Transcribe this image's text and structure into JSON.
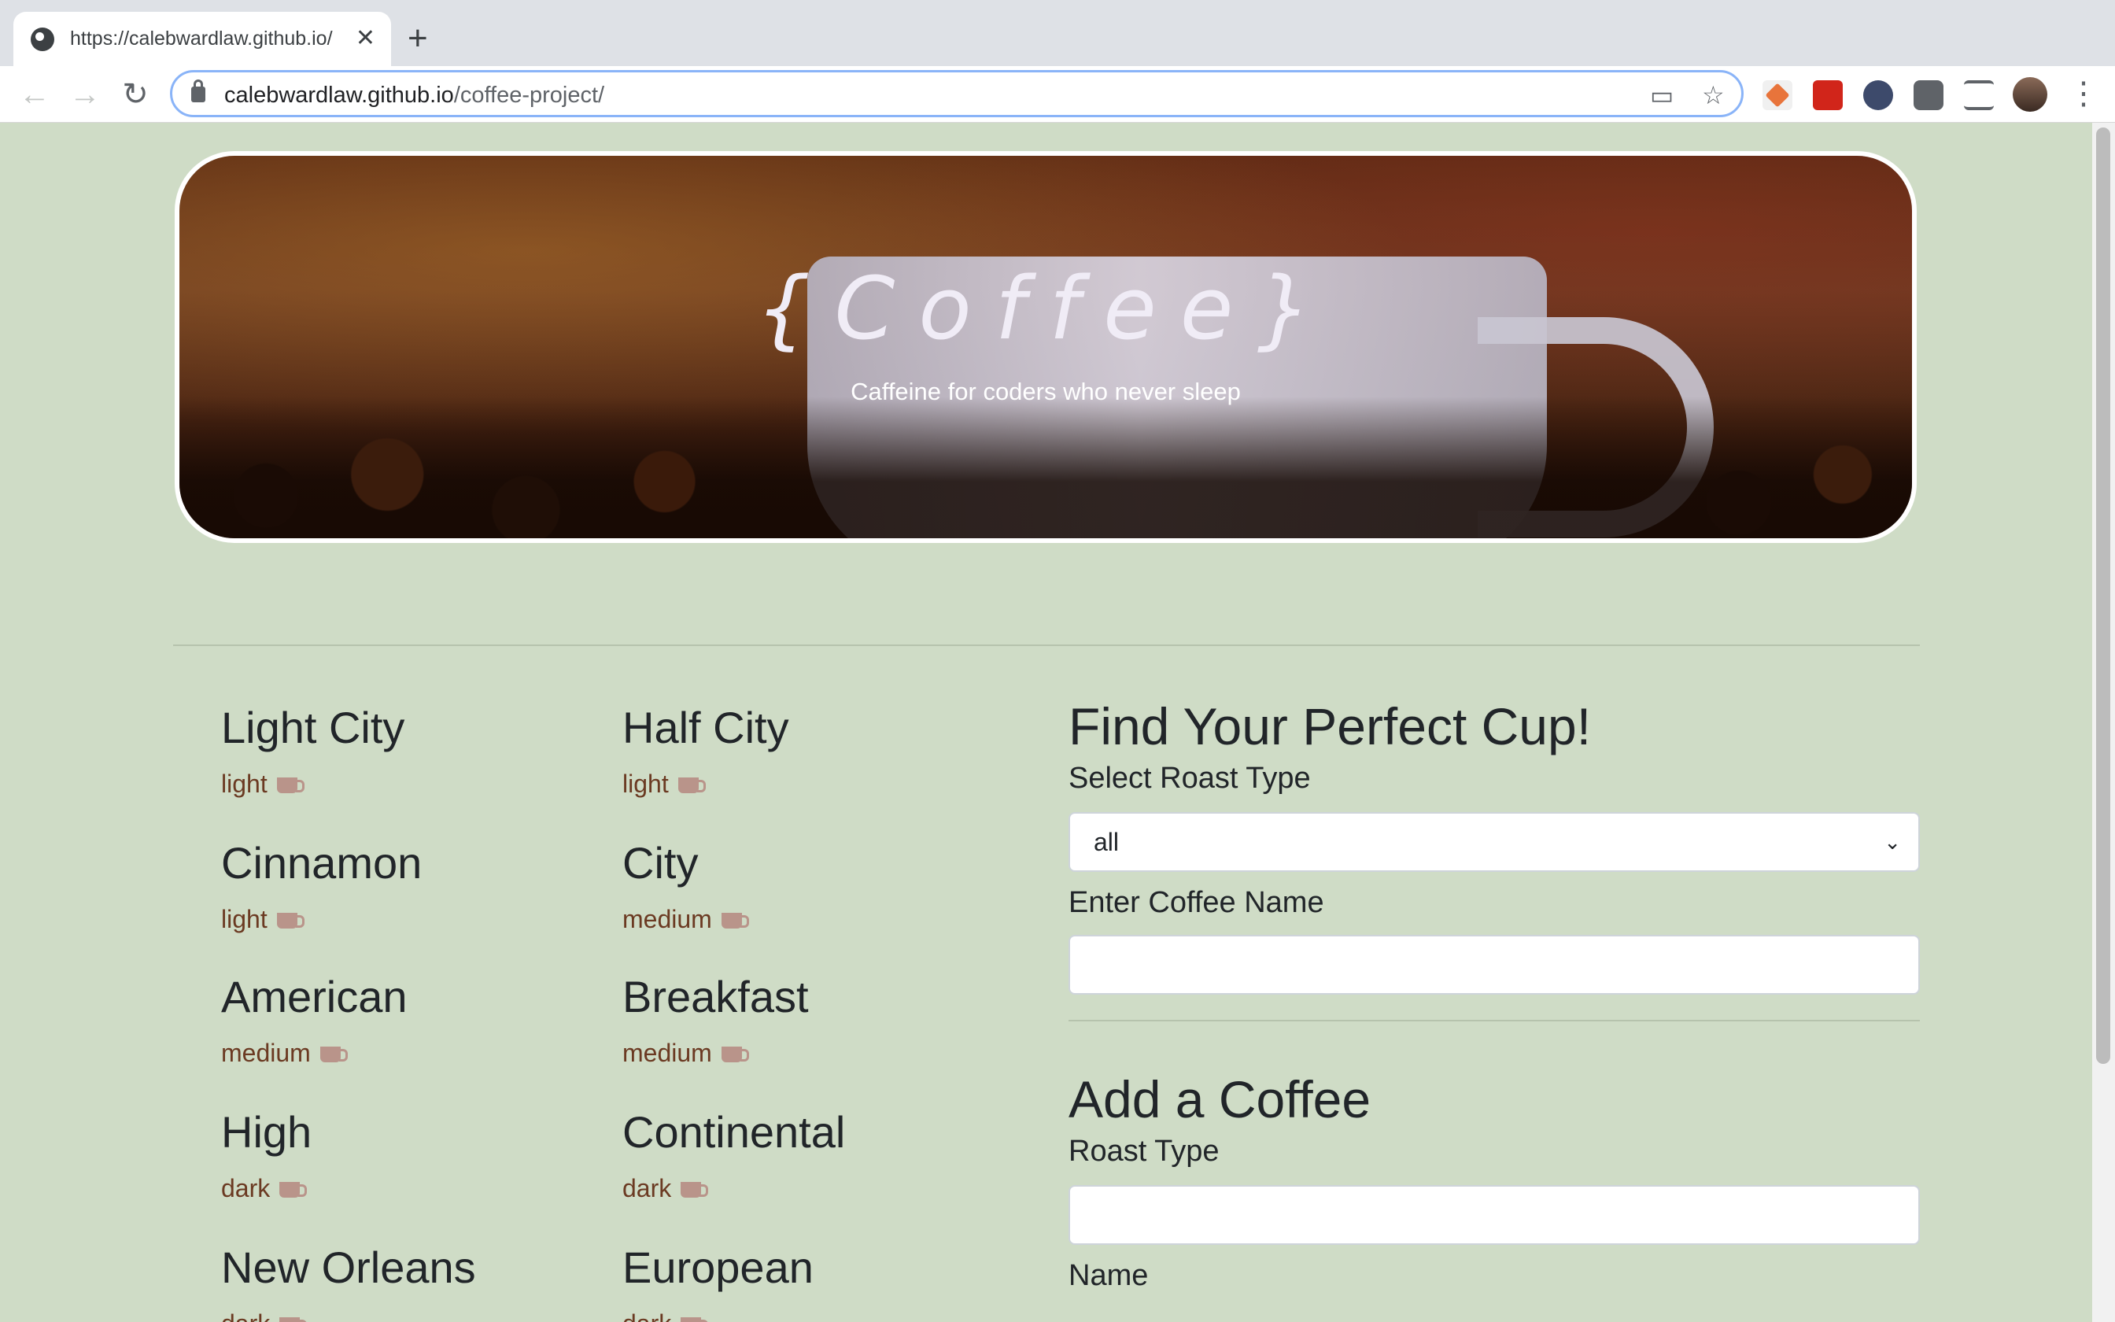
{
  "browser": {
    "tab_title": "https://calebwardlaw.github.io/",
    "tab_close": "✕",
    "new_tab": "+",
    "url_host": "calebwardlaw.github.io",
    "url_path": "/coffee-project/",
    "back": "←",
    "forward": "→",
    "reload": "↻",
    "cast_icon": "▭",
    "star_icon": "☆",
    "menu": "⋮"
  },
  "hero": {
    "title": "{Coffee}",
    "subtitle": "Caffeine for coders who never sleep"
  },
  "coffees": [
    {
      "name": "Light City",
      "roast": "light"
    },
    {
      "name": "Half City",
      "roast": "light"
    },
    {
      "name": "Cinnamon",
      "roast": "light"
    },
    {
      "name": "City",
      "roast": "medium"
    },
    {
      "name": "American",
      "roast": "medium"
    },
    {
      "name": "Breakfast",
      "roast": "medium"
    },
    {
      "name": "High",
      "roast": "dark"
    },
    {
      "name": "Continental",
      "roast": "dark"
    },
    {
      "name": "New Orleans",
      "roast": "dark"
    },
    {
      "name": "European",
      "roast": "dark"
    }
  ],
  "find": {
    "heading": "Find Your Perfect Cup!",
    "roast_label": "Select Roast Type",
    "roast_value": "all",
    "name_label": "Enter Coffee Name",
    "name_value": ""
  },
  "add": {
    "heading": "Add a Coffee",
    "roast_label": "Roast Type",
    "roast_value": "",
    "name_label": "Name"
  },
  "colors": {
    "page_bg": "#cfdcc6",
    "roast_text": "#6b3a22",
    "heading_text": "#212529"
  }
}
